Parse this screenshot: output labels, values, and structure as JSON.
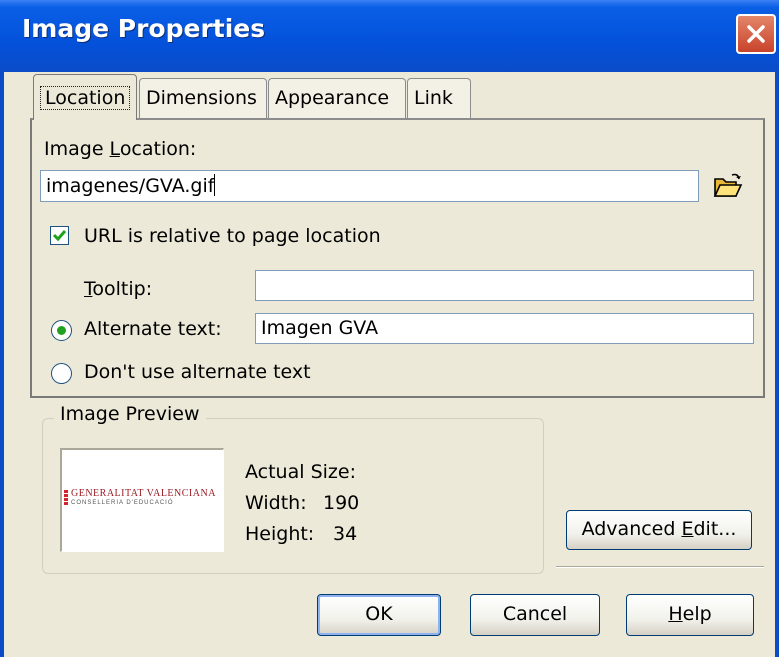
{
  "window": {
    "title": "Image Properties"
  },
  "tabs": [
    {
      "label": "Location",
      "active": true
    },
    {
      "label": "Dimensions",
      "active": false
    },
    {
      "label": "Appearance",
      "active": false
    },
    {
      "label": "Link",
      "active": false
    }
  ],
  "location": {
    "image_location_label_pre": "Image ",
    "image_location_label_key": "L",
    "image_location_label_post": "ocation:",
    "image_location_value": "imagenes/GVA.gif",
    "relative_url_label": "URL is relative to page location",
    "relative_url_checked": true,
    "tooltip_label_key": "T",
    "tooltip_label_post": "ooltip:",
    "tooltip_value": "",
    "alt_text_label": "Alternate text:",
    "alt_text_selected": true,
    "alt_text_value": "Imagen GVA",
    "no_alt_label": "Don't use alternate text",
    "no_alt_selected": false
  },
  "preview": {
    "group_label": "Image Preview",
    "actual_size_label": "Actual Size:",
    "width_label": "Width:",
    "width_value": "190",
    "height_label": "Height:",
    "height_value": "34",
    "logo_text_top": "GENERALITAT VALENCIANA",
    "logo_text_bottom": "CONSELLERIA D'EDUCACIÓ"
  },
  "buttons": {
    "advanced_edit_pre": "Advanced ",
    "advanced_edit_key": "E",
    "advanced_edit_post": "dit...",
    "ok": "OK",
    "cancel": "Cancel",
    "help_key": "H",
    "help_post": "elp"
  },
  "colors": {
    "titlebar": "#0451DA",
    "dialog_bg": "#ECE9D8",
    "check_green": "#21A121",
    "close_red": "#C8432B"
  },
  "icons": {
    "browse": "open-folder-icon",
    "close": "close-icon"
  }
}
